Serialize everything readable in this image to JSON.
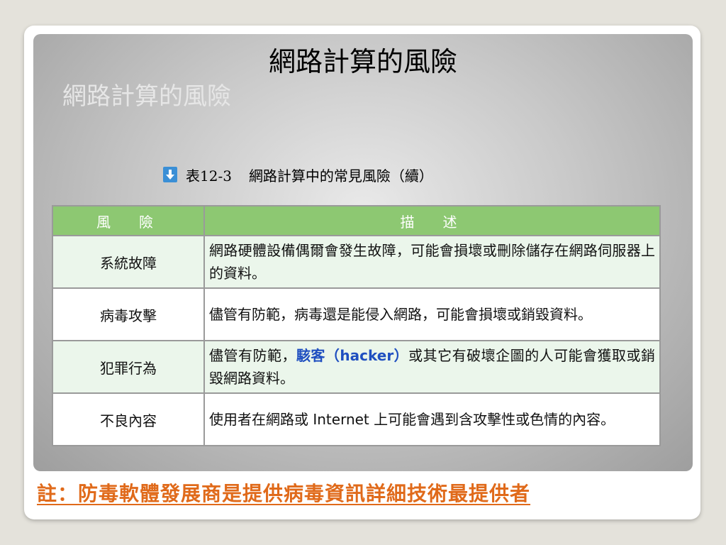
{
  "slide": {
    "title": "網路計算的風險",
    "ghost_title": "網路計算的風險"
  },
  "table_caption": {
    "icon": "down-arrow-icon",
    "label": "表12-3",
    "title": "網路計算中的常見風險（續）"
  },
  "table": {
    "headers": [
      "風　險",
      "描　述"
    ],
    "rows": [
      {
        "name": "系統故障",
        "desc_before": "網路硬體設備偶爾會發生故障，可能會損壞或刪除儲存在網路伺服器上的資料。",
        "desc_highlight": "",
        "desc_after": ""
      },
      {
        "name": "病毒攻擊",
        "desc_before": "儘管有防範，病毒還是能侵入網路，可能會損壞或銷毀資料。",
        "desc_highlight": "",
        "desc_after": ""
      },
      {
        "name": "犯罪行為",
        "desc_before": "儘管有防範，",
        "desc_highlight": "駭客（hacker）",
        "desc_after": "或其它有破壞企圖的人可能會獲取或銷毀網路資料。"
      },
      {
        "name": "不良內容",
        "desc_before": "使用者在網路或 Internet 上可能會遇到含攻擊性或色情的內容。",
        "desc_highlight": "",
        "desc_after": ""
      }
    ]
  },
  "note": "註：防毒軟體發展商是提供病毒資訊詳細技術最提供者",
  "colors": {
    "header_green": "#8dc872",
    "row_green": "#ebf6eb",
    "highlight_blue": "#1f4fc0",
    "note_orange": "#e06a1a",
    "arrow_blue": "#3a8fd6"
  }
}
